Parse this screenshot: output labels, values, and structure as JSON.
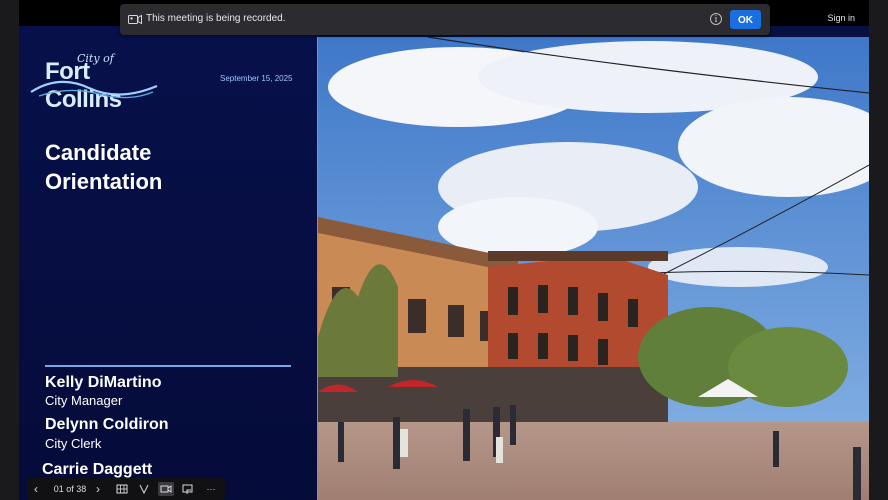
{
  "recording_banner": {
    "message": "This meeting is being recorded.",
    "ok_label": "OK",
    "info_glyph": "i"
  },
  "topbar": {
    "signin_label": "Sign in"
  },
  "slide": {
    "logo": {
      "small": "City of",
      "main": "Fort Collins"
    },
    "date": "September 15, 2025",
    "title_line1": "Candidate",
    "title_line2": "Orientation",
    "presenters": [
      {
        "name": "Kelly DiMartino",
        "role": "City Manager"
      },
      {
        "name": "Delynn Coldiron",
        "role": "City Clerk"
      },
      {
        "name": "Carrie Daggett",
        "role": ""
      }
    ]
  },
  "toolbar": {
    "prev_glyph": "‹",
    "page_indicator": "01 of 38",
    "next_glyph": "›",
    "more_glyph": "···"
  },
  "colors": {
    "slide_bg": "#07104a",
    "accent": "#1a6fe0",
    "divider": "#7ea6e6"
  }
}
